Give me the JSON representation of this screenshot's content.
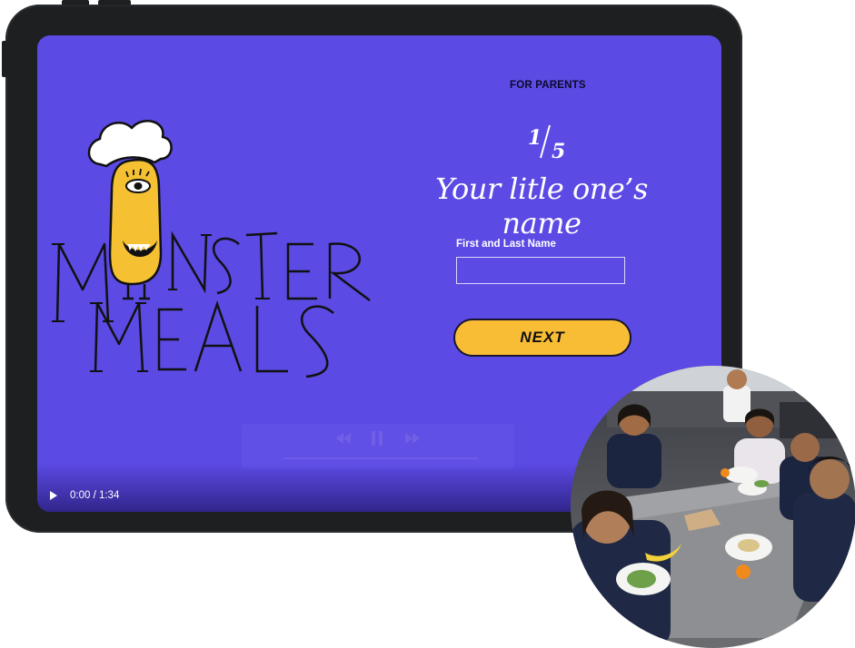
{
  "app": {
    "logo_text_line1": "MONSTER",
    "logo_text_line2": "MEALS"
  },
  "form": {
    "section_label": "FOR PARENTS",
    "step_current": "1",
    "step_total": "5",
    "heading": "Your litle one’s name",
    "field_label": "First and Last Name",
    "field_value": "",
    "field_placeholder": "",
    "next_button": "NEXT"
  },
  "video": {
    "time_display": "0:00 / 1:34",
    "play_icon": "play-icon",
    "progress": 0
  },
  "colors": {
    "screen_bg": "#5b4ae3",
    "button_bg": "#f9bd35",
    "device_frame": "#1d1f21",
    "monster_body": "#f5c133"
  }
}
